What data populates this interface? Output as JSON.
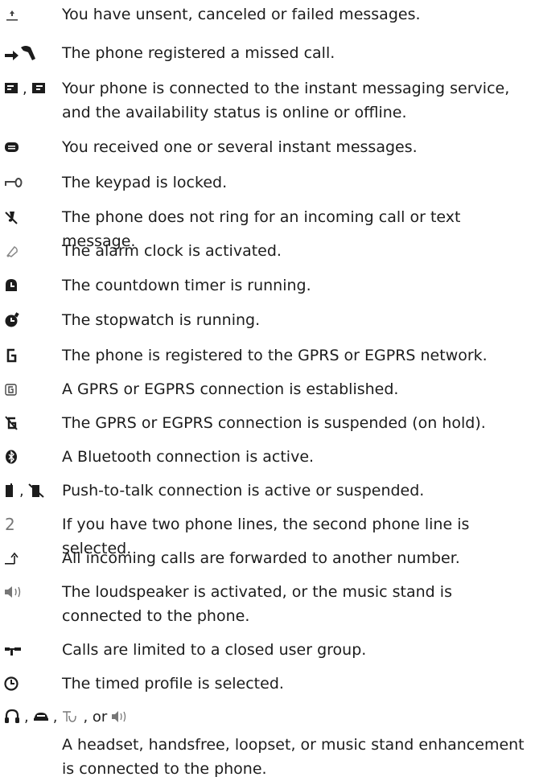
{
  "entries": [
    {
      "icon": "unsent-message-icon",
      "text": "You have unsent, canceled or failed messages."
    },
    {
      "icon": "missed-call-icon",
      "text": "The phone registered a missed call."
    },
    {
      "icon": "im-online-icon",
      "icon2": "im-offline-icon",
      "separator": ",",
      "text": "Your phone is connected to the instant messaging service, and the availability status is online or offline."
    },
    {
      "icon": "instant-message-icon",
      "text": "You received one or several instant messages."
    },
    {
      "icon": "keypad-lock-icon",
      "text": "The keypad is locked."
    },
    {
      "icon": "silent-icon",
      "text": "The phone does not ring for an incoming call or text message."
    },
    {
      "icon": "alarm-clock-icon",
      "text": "The alarm clock is activated."
    },
    {
      "icon": "countdown-timer-icon",
      "text": "The countdown timer is running."
    },
    {
      "icon": "stopwatch-icon",
      "text": "The stopwatch is running."
    },
    {
      "icon": "gprs-registered-icon",
      "text": "The phone is registered to the GPRS or EGPRS network."
    },
    {
      "icon": "gprs-connection-icon",
      "text": "A GPRS or EGPRS connection is established."
    },
    {
      "icon": "gprs-suspended-icon",
      "text": "The GPRS or EGPRS connection is suspended (on hold)."
    },
    {
      "icon": "bluetooth-icon",
      "text": "A Bluetooth connection is active."
    },
    {
      "icon": "ptt-active-icon",
      "icon2": "ptt-suspended-icon",
      "separator": ",",
      "text": "Push-to-talk connection is active or suspended."
    },
    {
      "icon": "second-line-icon",
      "glyph": "2",
      "text": "If you have two phone lines, the second phone line is selected."
    },
    {
      "icon": "call-forward-icon",
      "text": "All incoming calls are forwarded to another number."
    },
    {
      "icon": "loudspeaker-icon",
      "text": "The loudspeaker is activated, or the music stand is connected to the phone."
    },
    {
      "icon": "closed-user-group-icon",
      "text": "Calls are limited to a closed user group."
    },
    {
      "icon": "timed-profile-icon",
      "text": "The timed profile is selected."
    }
  ],
  "enhancements": {
    "icons": [
      "headset-icon",
      "handsfree-icon",
      "loopset-icon",
      "music-stand-icon"
    ],
    "separator1": ",",
    "separator2": ",",
    "separator3": ", or",
    "text": "A headset, handsfree, loopset, or music stand enhancement is connected to the phone."
  }
}
